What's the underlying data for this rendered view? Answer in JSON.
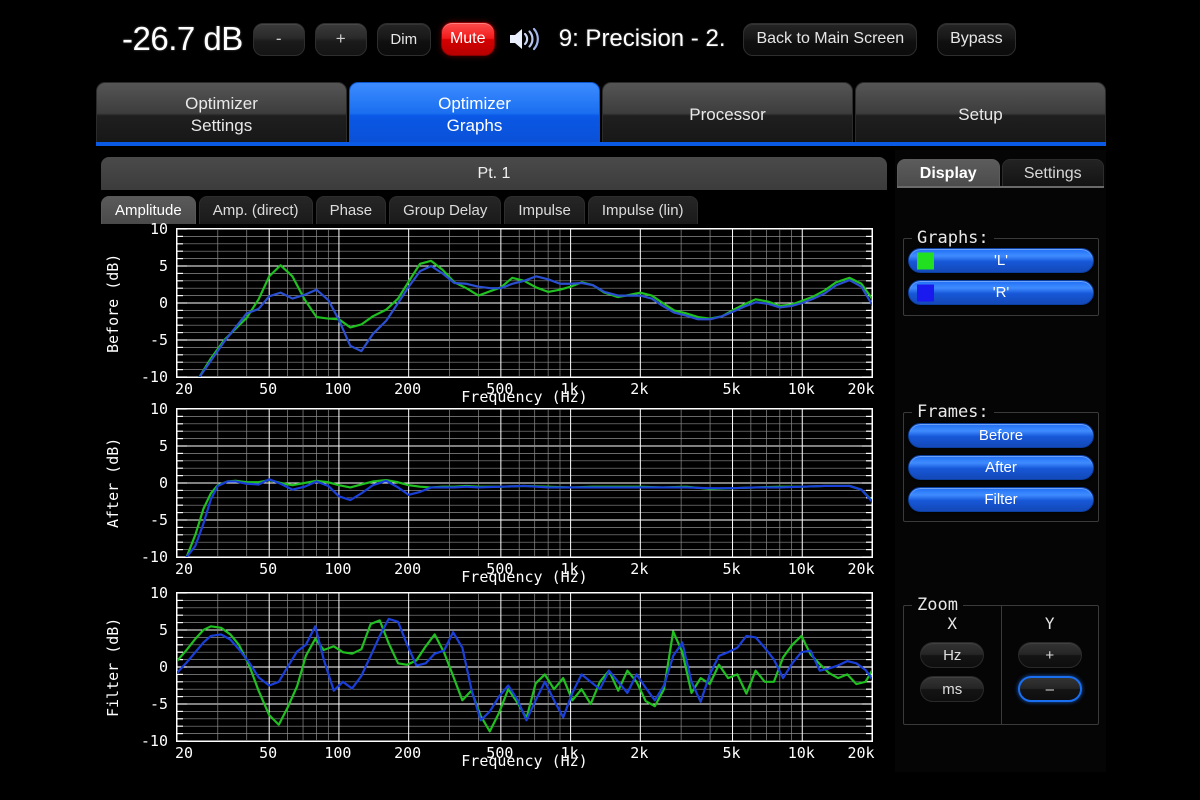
{
  "topbar": {
    "volume": "-26.7 dB",
    "minus_label": "-",
    "plus_label": "+",
    "dim_label": "Dim",
    "mute_label": "Mute",
    "speaker_icon": "speaker-volume-icon",
    "preset": "9: Precision - 2.",
    "back_label": "Back to Main Screen",
    "bypass_label": "Bypass",
    "mute_color": "#f01a1a"
  },
  "main_tabs": [
    {
      "line1": "Optimizer",
      "line2": "Settings",
      "active": false
    },
    {
      "line1": "Optimizer",
      "line2": "Graphs",
      "active": true
    },
    {
      "line1": "Processor",
      "line2": "",
      "active": false
    },
    {
      "line1": "Setup",
      "line2": "",
      "active": false
    }
  ],
  "accent_color": "#0b5ae6",
  "point_header": "Pt. 1",
  "sub_tabs": [
    {
      "label": "Amplitude",
      "active": true
    },
    {
      "label": "Amp. (direct)",
      "active": false
    },
    {
      "label": "Phase",
      "active": false
    },
    {
      "label": "Group Delay",
      "active": false
    },
    {
      "label": "Impulse",
      "active": false
    },
    {
      "label": "Impulse (lin)",
      "active": false
    }
  ],
  "right_panel": {
    "tabs": [
      {
        "label": "Display",
        "active": true
      },
      {
        "label": "Settings",
        "active": false
      }
    ],
    "graphs_legend": "Graphs:",
    "graph_buttons": [
      {
        "label": "'L'",
        "color": "#20e020"
      },
      {
        "label": "'R'",
        "color": "#1a1aee"
      }
    ],
    "frames_legend": "Frames:",
    "frame_buttons": [
      {
        "label": "Before"
      },
      {
        "label": "After"
      },
      {
        "label": "Filter"
      }
    ],
    "zoom_legend": "Zoom",
    "zoom_x_header": "X",
    "zoom_y_header": "Y",
    "zoom_x_buttons": [
      {
        "label": "Hz",
        "focused": false
      },
      {
        "label": "ms",
        "focused": false
      }
    ],
    "zoom_y_buttons": [
      {
        "label": "+",
        "focused": false
      },
      {
        "label": "–",
        "focused": true
      }
    ]
  },
  "chart_data": [
    {
      "type": "line",
      "title": "Before",
      "ylabel": "Before (dB)",
      "xlabel": "Frequency (Hz)",
      "xscale": "log",
      "xlim": [
        20,
        20000
      ],
      "ylim": [
        -10,
        10
      ],
      "yticks": [
        10,
        5,
        0,
        -5,
        -10
      ],
      "xticks": [
        20,
        50,
        100,
        200,
        500,
        1000,
        2000,
        5000,
        10000,
        20000
      ],
      "xticklabels": [
        "20",
        "50",
        "100",
        "200",
        "500",
        "1k",
        "2k",
        "5k",
        "10k",
        "20k"
      ],
      "grid": true,
      "series": [
        {
          "name": "'L'",
          "color": "#20c020",
          "x": [
            25,
            28,
            32,
            36,
            40,
            45,
            50,
            56,
            63,
            71,
            80,
            90,
            100,
            112,
            125,
            140,
            160,
            180,
            200,
            224,
            250,
            280,
            315,
            355,
            400,
            450,
            500,
            560,
            630,
            710,
            800,
            900,
            1000,
            1120,
            1250,
            1400,
            1600,
            1800,
            2000,
            2240,
            2500,
            2800,
            3150,
            3550,
            4000,
            4500,
            5000,
            5600,
            6300,
            7100,
            8000,
            9000,
            10000,
            11200,
            12500,
            14000,
            16000,
            18000,
            20000
          ],
          "y": [
            -10.0,
            -7.5,
            -5.0,
            -3.4,
            -2.0,
            0.5,
            3.6,
            5.1,
            3.6,
            0.5,
            -1.9,
            -2.1,
            -2.2,
            -3.3,
            -2.9,
            -1.8,
            -0.9,
            0.6,
            2.9,
            5.3,
            5.7,
            4.5,
            2.8,
            2.0,
            1.0,
            1.6,
            2.1,
            3.4,
            3.0,
            2.1,
            1.5,
            1.8,
            2.2,
            2.8,
            2.4,
            1.4,
            0.8,
            1.1,
            1.4,
            1.0,
            0.0,
            -1.0,
            -1.4,
            -1.9,
            -2.1,
            -1.8,
            -1.0,
            -0.2,
            0.5,
            0.2,
            -0.4,
            -0.2,
            0.3,
            0.9,
            1.7,
            2.8,
            3.4,
            2.6,
            0.6
          ]
        },
        {
          "name": "'R'",
          "color": "#2a4fd0",
          "x": [
            25,
            28,
            32,
            36,
            40,
            45,
            50,
            56,
            63,
            71,
            80,
            90,
            100,
            112,
            125,
            140,
            160,
            180,
            200,
            224,
            250,
            280,
            315,
            355,
            400,
            450,
            500,
            560,
            630,
            710,
            800,
            900,
            1000,
            1120,
            1250,
            1400,
            1600,
            1800,
            2000,
            2240,
            2500,
            2800,
            3150,
            3550,
            4000,
            4500,
            5000,
            5600,
            6300,
            7100,
            8000,
            9000,
            10000,
            11200,
            12500,
            14000,
            16000,
            18000,
            20000
          ],
          "y": [
            -10.0,
            -7.8,
            -5.2,
            -3.2,
            -1.4,
            -0.8,
            0.9,
            1.4,
            0.6,
            1.1,
            1.8,
            0.4,
            -2.3,
            -5.8,
            -6.5,
            -4.2,
            -2.4,
            0.0,
            2.2,
            4.3,
            5.0,
            4.0,
            2.7,
            2.6,
            2.2,
            2.0,
            2.0,
            2.6,
            3.0,
            3.6,
            3.2,
            2.6,
            2.6,
            2.7,
            2.4,
            1.5,
            1.0,
            1.0,
            1.0,
            0.6,
            -0.4,
            -1.3,
            -1.7,
            -2.2,
            -2.2,
            -1.8,
            -1.2,
            -0.5,
            0.1,
            -0.1,
            -0.6,
            -0.4,
            0.0,
            0.6,
            1.3,
            2.4,
            3.1,
            2.2,
            -0.2
          ]
        }
      ]
    },
    {
      "type": "line",
      "title": "After",
      "ylabel": "After (dB)",
      "xlabel": "Frequency (Hz)",
      "xscale": "log",
      "xlim": [
        20,
        20000
      ],
      "ylim": [
        -10,
        10
      ],
      "yticks": [
        10,
        5,
        0,
        -5,
        -10
      ],
      "xticks": [
        20,
        50,
        100,
        200,
        500,
        1000,
        2000,
        5000,
        10000,
        20000
      ],
      "xticklabels": [
        "20",
        "50",
        "100",
        "200",
        "500",
        "1k",
        "2k",
        "5k",
        "10k",
        "20k"
      ],
      "grid": true,
      "series": [
        {
          "name": "'L'",
          "color": "#20c020",
          "x": [
            22,
            24,
            26,
            28,
            30,
            33,
            36,
            40,
            45,
            50,
            56,
            63,
            71,
            80,
            90,
            100,
            112,
            125,
            140,
            160,
            180,
            200,
            224,
            250,
            280,
            315,
            355,
            400,
            500,
            630,
            800,
            1000,
            1250,
            1600,
            2000,
            2500,
            3150,
            4000,
            5000,
            6300,
            8000,
            10000,
            12500,
            16000,
            18000,
            20000
          ],
          "y": [
            -10.0,
            -7.0,
            -3.5,
            -1.4,
            -0.3,
            0.2,
            0.3,
            0.1,
            0.1,
            0.4,
            0.0,
            -0.3,
            0.0,
            0.3,
            0.1,
            -0.3,
            -0.6,
            -0.2,
            0.2,
            0.4,
            0.1,
            -0.3,
            -0.5,
            -0.6,
            -0.5,
            -0.5,
            -0.4,
            -0.5,
            -0.5,
            -0.4,
            -0.5,
            -0.6,
            -0.5,
            -0.5,
            -0.5,
            -0.6,
            -0.5,
            -0.8,
            -0.7,
            -0.6,
            -0.5,
            -0.5,
            -0.4,
            -0.4,
            -0.9,
            -2.4
          ]
        },
        {
          "name": "'R'",
          "color": "#1a3fd8",
          "x": [
            22,
            24,
            26,
            28,
            30,
            33,
            36,
            40,
            45,
            50,
            56,
            63,
            71,
            80,
            90,
            100,
            112,
            125,
            140,
            160,
            180,
            200,
            224,
            250,
            280,
            315,
            355,
            400,
            500,
            630,
            800,
            1000,
            1250,
            1600,
            2000,
            2500,
            3150,
            4000,
            5000,
            6300,
            8000,
            10000,
            12500,
            16000,
            18000,
            20000
          ],
          "y": [
            -10.0,
            -8.5,
            -5.5,
            -2.2,
            -0.4,
            0.2,
            0.2,
            -0.1,
            -0.2,
            0.5,
            -0.1,
            -0.9,
            -0.5,
            0.2,
            -0.4,
            -1.8,
            -2.3,
            -1.4,
            -0.3,
            0.3,
            -0.6,
            -1.6,
            -1.2,
            -0.6,
            -0.6,
            -0.6,
            -0.5,
            -0.6,
            -0.5,
            -0.4,
            -0.6,
            -0.6,
            -0.6,
            -0.6,
            -0.6,
            -0.6,
            -0.6,
            -0.7,
            -0.7,
            -0.6,
            -0.6,
            -0.5,
            -0.4,
            -0.4,
            -0.9,
            -2.5
          ]
        }
      ]
    },
    {
      "type": "line",
      "title": "Filter",
      "ylabel": "Filter (dB)",
      "xlabel": "Frequency (Hz)",
      "xscale": "log",
      "xlim": [
        20,
        20000
      ],
      "ylim": [
        -10,
        10
      ],
      "yticks": [
        10,
        5,
        0,
        -5,
        -10
      ],
      "xticks": [
        20,
        50,
        100,
        200,
        500,
        1000,
        2000,
        5000,
        10000,
        20000
      ],
      "xticklabels": [
        "20",
        "50",
        "100",
        "200",
        "500",
        "1k",
        "2k",
        "5k",
        "10k",
        "20k"
      ],
      "grid": true,
      "series": [
        {
          "name": "'L'",
          "color": "#20c020",
          "x": [
            20,
            22,
            24,
            26,
            28,
            31,
            34,
            37,
            41,
            45,
            50,
            55,
            60,
            66,
            72,
            79,
            86,
            95,
            104,
            114,
            125,
            137,
            150,
            164,
            180,
            197,
            216,
            237,
            259,
            284,
            311,
            341,
            373,
            409,
            448,
            491,
            538,
            589,
            645,
            707,
            774,
            848,
            929,
            1018,
            1115,
            1221,
            1338,
            1465,
            1605,
            1758,
            1926,
            2109,
            2310,
            2530,
            2772,
            3036,
            3325,
            3642,
            3989,
            4369,
            4786,
            5242,
            5742,
            6290,
            6889,
            7546,
            8265,
            9053,
            9916,
            10861,
            11896,
            13029,
            14271,
            15631,
            17121,
            18754,
            20000
          ],
          "y": [
            0.8,
            2.3,
            3.8,
            5.0,
            5.5,
            5.3,
            4.4,
            3.0,
            0.2,
            -3.2,
            -6.5,
            -7.8,
            -5.5,
            -2.6,
            1.5,
            3.8,
            2.3,
            2.8,
            2.0,
            1.8,
            2.4,
            5.8,
            6.3,
            3.2,
            0.5,
            0.3,
            0.9,
            2.8,
            4.4,
            2.0,
            -1.2,
            -4.5,
            -3.2,
            -6.6,
            -8.7,
            -6.2,
            -3.0,
            -4.8,
            -6.9,
            -2.2,
            -1.0,
            -3.0,
            -1.5,
            -4.5,
            -3.0,
            -5.0,
            -2.0,
            -0.5,
            -3.2,
            -0.5,
            -2.0,
            -4.6,
            -5.3,
            -3.0,
            4.8,
            2.0,
            -3.5,
            -1.5,
            -2.3,
            0.3,
            -1.5,
            -1.0,
            -3.6,
            -0.5,
            -2.0,
            -2.0,
            1.3,
            3.0,
            4.2,
            1.7,
            0.4,
            -0.8,
            -1.5,
            -1.0,
            -2.3,
            -2.0,
            -0.5,
            -1.2,
            -2.2,
            -2.8,
            -4.8,
            -5.2,
            -3.6,
            -2.4,
            -2.8,
            -2.2,
            -1.8,
            0.3,
            1.6
          ]
        },
        {
          "name": "'R'",
          "color": "#1a3fd8",
          "x": [
            20,
            22,
            24,
            26,
            28,
            31,
            34,
            37,
            41,
            45,
            50,
            55,
            60,
            66,
            72,
            79,
            86,
            95,
            104,
            114,
            125,
            137,
            150,
            164,
            180,
            197,
            216,
            237,
            259,
            284,
            311,
            341,
            373,
            409,
            448,
            491,
            538,
            589,
            645,
            707,
            774,
            848,
            929,
            1018,
            1115,
            1221,
            1338,
            1465,
            1605,
            1758,
            1926,
            2109,
            2310,
            2530,
            2772,
            3036,
            3325,
            3642,
            3989,
            4369,
            4786,
            5242,
            5742,
            6290,
            6889,
            7546,
            8265,
            9053,
            9916,
            10861,
            11896,
            13029,
            14271,
            15631,
            17121,
            18754,
            20000
          ],
          "y": [
            -0.8,
            0.6,
            2.0,
            3.3,
            4.2,
            4.4,
            3.7,
            2.4,
            0.6,
            -1.4,
            -2.5,
            -2.0,
            0.0,
            2.1,
            3.0,
            5.5,
            1.0,
            -3.2,
            -2.0,
            -2.9,
            -1.2,
            1.5,
            4.2,
            6.5,
            6.1,
            3.0,
            0.2,
            0.5,
            1.8,
            2.2,
            4.7,
            2.6,
            -3.0,
            -7.2,
            -6.0,
            -4.0,
            -2.5,
            -4.4,
            -7.2,
            -4.5,
            -2.0,
            -4.5,
            -6.8,
            -3.5,
            -1.0,
            -2.0,
            -3.0,
            -0.5,
            -2.0,
            -3.5,
            -1.0,
            -2.8,
            -4.5,
            -2.5,
            1.5,
            3.3,
            -2.0,
            -4.7,
            -1.0,
            1.5,
            2.0,
            2.6,
            4.2,
            4.0,
            2.6,
            1.0,
            -1.5,
            0.5,
            2.0,
            2.2,
            -0.5,
            -0.2,
            0.2,
            0.8,
            0.5,
            -0.4,
            -1.6,
            -1.1,
            -2.6,
            -3.4,
            -5.0,
            -4.3,
            -3.0,
            -2.5,
            -2.0,
            -0.5,
            0.8,
            1.8
          ]
        }
      ]
    }
  ]
}
